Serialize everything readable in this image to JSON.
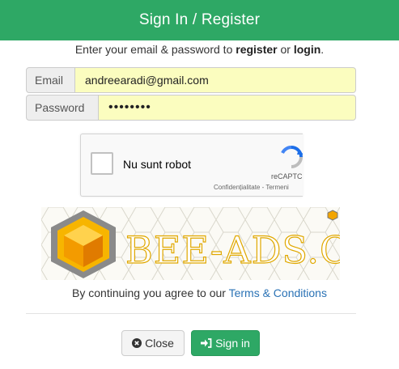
{
  "header": {
    "title": "Sign In / Register"
  },
  "intro": {
    "prefix": "Enter your email & password to ",
    "register": "register",
    "middle": " or ",
    "login": "login",
    "suffix": "."
  },
  "form": {
    "email_label": "Email",
    "email_value": "andreearadi@gmail.com",
    "password_label": "Password",
    "password_value": "••••••••"
  },
  "captcha": {
    "label": "Nu sunt robot",
    "brand": "reCAPTCHA",
    "privacy": "Confidențialitate - Termeni"
  },
  "banner": {
    "text": "BEE-ADS.C"
  },
  "terms": {
    "prefix": "By continuing you agree to our ",
    "link": "Terms & Conditions"
  },
  "buttons": {
    "close": "Close",
    "signin": "Sign in"
  },
  "colors": {
    "accent": "#2ea865",
    "input_fill": "#fbfdbf",
    "link": "#2a72b5"
  }
}
